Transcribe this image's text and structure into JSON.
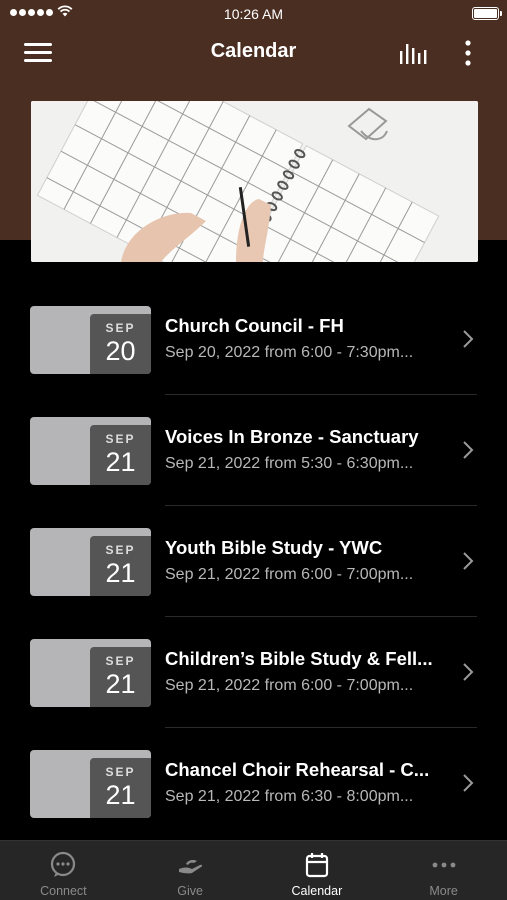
{
  "status_bar": {
    "time": "10:26 AM"
  },
  "header": {
    "title": "Calendar"
  },
  "events": [
    {
      "month": "SEP",
      "day": "20",
      "title": "Church Council - FH",
      "subtitle": "Sep 20, 2022 from 6:00 - 7:30pm..."
    },
    {
      "month": "SEP",
      "day": "21",
      "title": "Voices In Bronze - Sanctuary",
      "subtitle": "Sep 21, 2022 from 5:30 - 6:30pm..."
    },
    {
      "month": "SEP",
      "day": "21",
      "title": "Youth Bible Study - YWC",
      "subtitle": "Sep 21, 2022 from 6:00 - 7:00pm..."
    },
    {
      "month": "SEP",
      "day": "21",
      "title": "Children’s Bible Study & Fell...",
      "subtitle": "Sep 21, 2022 from 6:00 - 7:00pm..."
    },
    {
      "month": "SEP",
      "day": "21",
      "title": "Chancel Choir Rehearsal - C...",
      "subtitle": "Sep 21, 2022 from 6:30 - 8:00pm..."
    }
  ],
  "tabbar": {
    "items": [
      {
        "label": "Connect",
        "icon": "chat-bubble-icon",
        "active": false
      },
      {
        "label": "Give",
        "icon": "giving-hand-icon",
        "active": false
      },
      {
        "label": "Calendar",
        "icon": "calendar-icon",
        "active": true
      },
      {
        "label": "More",
        "icon": "more-dots-icon",
        "active": false
      }
    ]
  },
  "colors": {
    "header_bg": "#4a2e22",
    "background": "#000000",
    "tabbar_bg": "#262626",
    "active": "#ffffff",
    "inactive": "#8a8a8a"
  }
}
